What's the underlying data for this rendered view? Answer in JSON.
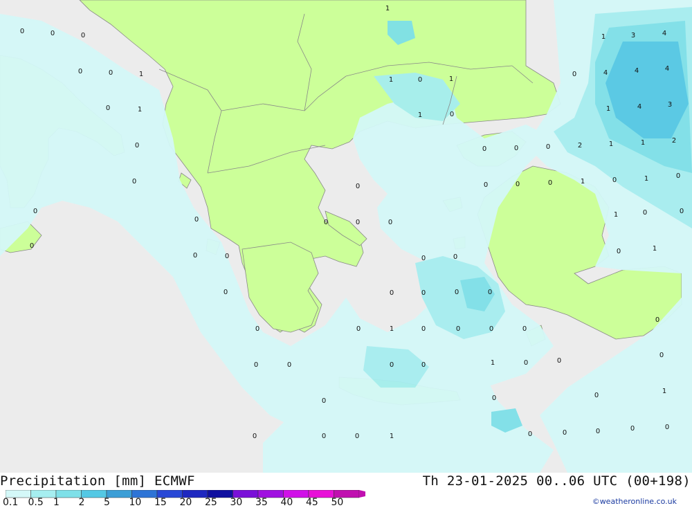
{
  "map": {
    "colors": {
      "sea": "#ececec",
      "land": "#ccff99",
      "border": "#888888",
      "precip_0_1": "#d4f8f8",
      "precip_0_5": "#a6eef0",
      "precip_1": "#7ee0e8",
      "precip_2": "#54c8e4",
      "precip_5": "#3c9ed6"
    },
    "point_values": [
      "0",
      "0",
      "0",
      "0",
      "0",
      "1",
      "0",
      "1",
      "0",
      "0",
      "0",
      "0",
      "0",
      "0",
      "0",
      "0",
      "1",
      "1",
      "0",
      "1",
      "1",
      "0",
      "0",
      "0",
      "0",
      "0",
      "0",
      "0",
      "0",
      "0",
      "0",
      "0",
      "0",
      "1",
      "0",
      "0",
      "0",
      "0",
      "0",
      "0",
      "0",
      "0",
      "0",
      "1",
      "0",
      "0",
      "0",
      "0",
      "0",
      "0",
      "1",
      "0",
      "0",
      "0",
      "0",
      "0",
      "0",
      "0",
      "1",
      "0",
      "1",
      "3",
      "4",
      "0",
      "4",
      "4",
      "4",
      "1",
      "4",
      "3",
      "2",
      "1",
      "1",
      "2",
      "0",
      "0",
      "0",
      "1",
      "0",
      "1",
      "0",
      "0",
      "1",
      "0",
      "0",
      "0",
      "1",
      "0",
      "0",
      "0"
    ]
  },
  "footer": {
    "legend_title": "Precipitation [mm] ECMWF",
    "valid_time": "Th 23-01-2025 00..06 UTC (00+198)",
    "credit": "©weatheronline.co.uk",
    "scale": [
      {
        "label": "0.1",
        "color": "#d4f8f8"
      },
      {
        "label": "0.5",
        "color": "#a6eef0"
      },
      {
        "label": "1",
        "color": "#7ee0e8"
      },
      {
        "label": "2",
        "color": "#54c8e4"
      },
      {
        "label": "5",
        "color": "#3c9ed6"
      },
      {
        "label": "10",
        "color": "#2e74d6"
      },
      {
        "label": "15",
        "color": "#2848d6"
      },
      {
        "label": "20",
        "color": "#1e28c0"
      },
      {
        "label": "25",
        "color": "#1010a0"
      },
      {
        "label": "30",
        "color": "#7a10d8"
      },
      {
        "label": "35",
        "color": "#a010e0"
      },
      {
        "label": "40",
        "color": "#d010e8"
      },
      {
        "label": "45",
        "color": "#e810d8"
      },
      {
        "label": "50",
        "color": "#c010b0"
      }
    ]
  }
}
